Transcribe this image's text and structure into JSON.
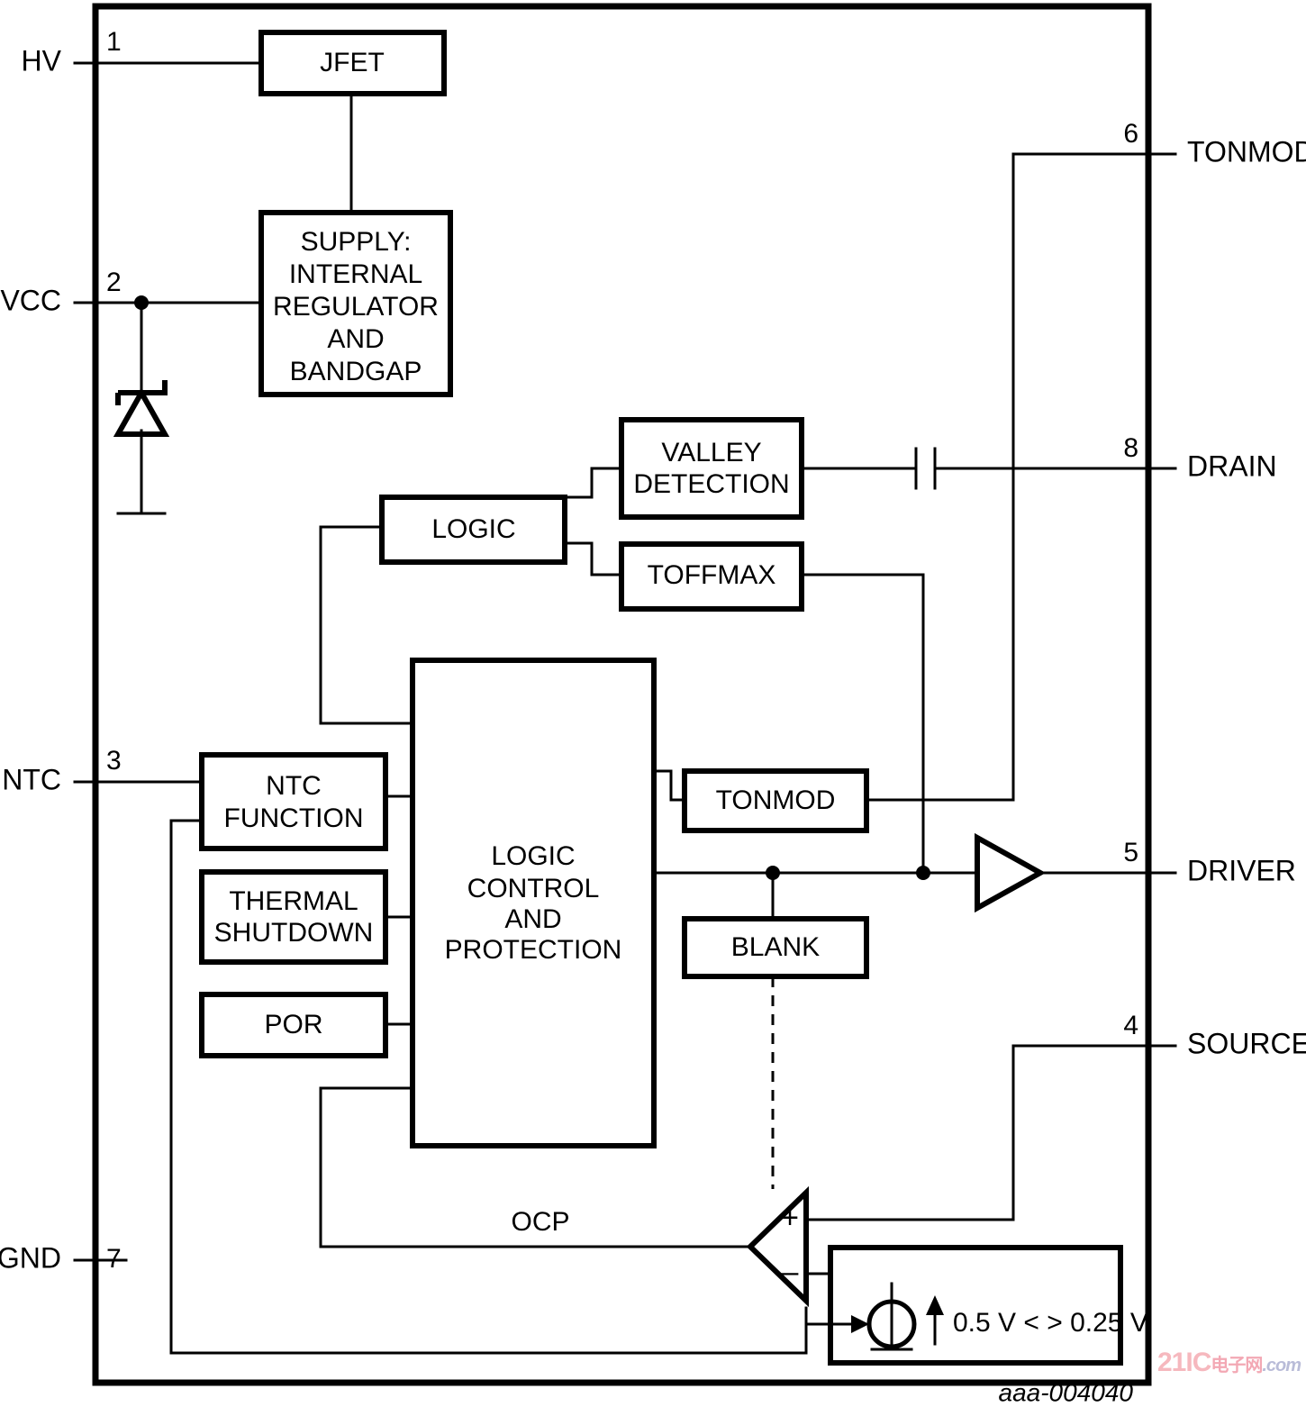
{
  "figure": {
    "id_label": "aaa-004040",
    "watermark": {
      "brand": "21IC",
      "cn": "电子网",
      "domain": ".com"
    }
  },
  "pins": {
    "left": [
      {
        "number": "1",
        "label": "HV"
      },
      {
        "number": "2",
        "label": "VCC"
      },
      {
        "number": "3",
        "label": "NTC"
      },
      {
        "number": "7",
        "label": "GND"
      }
    ],
    "right": [
      {
        "number": "6",
        "label": "TONMOD"
      },
      {
        "number": "8",
        "label": "DRAIN"
      },
      {
        "number": "5",
        "label": "DRIVER"
      },
      {
        "number": "4",
        "label": "SOURCE"
      }
    ]
  },
  "blocks": {
    "jfet": "JFET",
    "supply": [
      "SUPPLY:",
      "INTERNAL",
      "REGULATOR",
      "AND",
      "BANDGAP"
    ],
    "logic": "LOGIC",
    "valley_detection": [
      "VALLEY",
      "DETECTION"
    ],
    "toffmax": "TOFFMAX",
    "ntc_function": [
      "NTC",
      "FUNCTION"
    ],
    "thermal_shutdown": [
      "THERMAL",
      "SHUTDOWN"
    ],
    "por": "POR",
    "logic_control": [
      "LOGIC",
      "CONTROL",
      "AND",
      "PROTECTION"
    ],
    "tonmod": "TONMOD",
    "blank": "BLANK"
  },
  "annotations": {
    "ocp": "OCP",
    "threshold": "0.5 V < > 0.25 V",
    "comparator_plus": "+",
    "comparator_minus": "–"
  },
  "symbols": {
    "zener_diode": "zener-diode",
    "ground": "ground-symbol",
    "capacitor": "capacitor",
    "driver_buffer": "buffer-amplifier",
    "comparator": "comparator",
    "voltage_source": "voltage-source"
  },
  "colors": {
    "line": "#000000",
    "background": "#ffffff",
    "watermark_pink": "#f6b8be",
    "watermark_blue": "#b9bcd8"
  }
}
